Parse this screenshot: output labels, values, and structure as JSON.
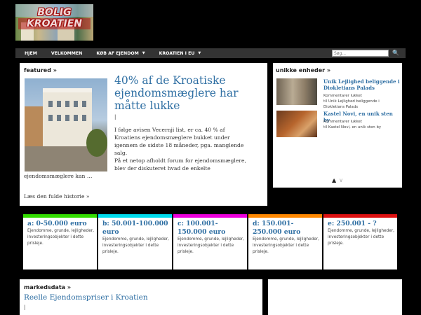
{
  "logo": {
    "line1": "BOLIG",
    "line2": "KROATIEN"
  },
  "nav": {
    "items": [
      {
        "label": "HJEM",
        "has_dropdown": false
      },
      {
        "label": "VELKOMMEN",
        "has_dropdown": false
      },
      {
        "label": "KØB AF EJENDOM",
        "has_dropdown": true
      },
      {
        "label": "KROATIEN I EU",
        "has_dropdown": true
      }
    ],
    "search_placeholder": "Søg...",
    "search_icon": "search-icon"
  },
  "featured": {
    "heading": "featured »",
    "headline": "40% af de Kroatiske ejendomsmæglere har måtte lukke",
    "cursor": "|",
    "body_lines": [
      "I følge avisen Vecernji list, er ca. 40 % af",
      "Kroatiens ejendomsmæglere bukket under",
      "igennem de sidste 18 måneder, pga. manglende",
      "salg.",
      "På et netop afholdt forum for ejendomsmæglere,",
      "blev der diskuteret hvad de enkelte",
      "ejendomsmæglere kan …"
    ],
    "read_more": "Læs den fulde historie »"
  },
  "unikke": {
    "heading": "unikke enheder »",
    "items": [
      {
        "title": "Unik Lejlighed beliggende i Diokletians Palads",
        "comments": "Kommentarer lukket",
        "sub": "til Unik Lejlighed beliggende i Diokletians Palads"
      },
      {
        "title": "Kastel Novi, en unik sten by",
        "comments": "Kommentarer lukket",
        "sub": "til Kastel Novi, en unik sten by"
      }
    ]
  },
  "price_ranges": [
    {
      "title": "a: 0-50.000 euro",
      "color": "#33dd00",
      "desc": "Ejendomme, grunde, lejligheder, investeringsobjekter i dette prisleje."
    },
    {
      "title": "b: 50.001-100.000 euro",
      "color": "#00ddee",
      "desc": "Ejendomme, grunde, lejligheder, investeringsobjekter i dette prisleje."
    },
    {
      "title": "c: 100.001-150.000 euro",
      "color": "#ee00dd",
      "desc": "Ejendomme, grunde, lejligheder, investeringsobjekter i dette prisleje."
    },
    {
      "title": "d: 150.001-250.000 euro",
      "color": "#ff8800",
      "desc": "Ejendomme, grunde, lejligheder, investeringsobjekter i dette prisleje."
    },
    {
      "title": "e: 250.001 - ?",
      "color": "#dd1111",
      "desc": "Ejendomme, grunde, lejligheder, investeringsobjekter i dette prisleje."
    }
  ],
  "markedsdata": {
    "heading": "markedsdata »",
    "title": "Reelle Ejendomspriser i Kroatien",
    "cursor": "|"
  }
}
